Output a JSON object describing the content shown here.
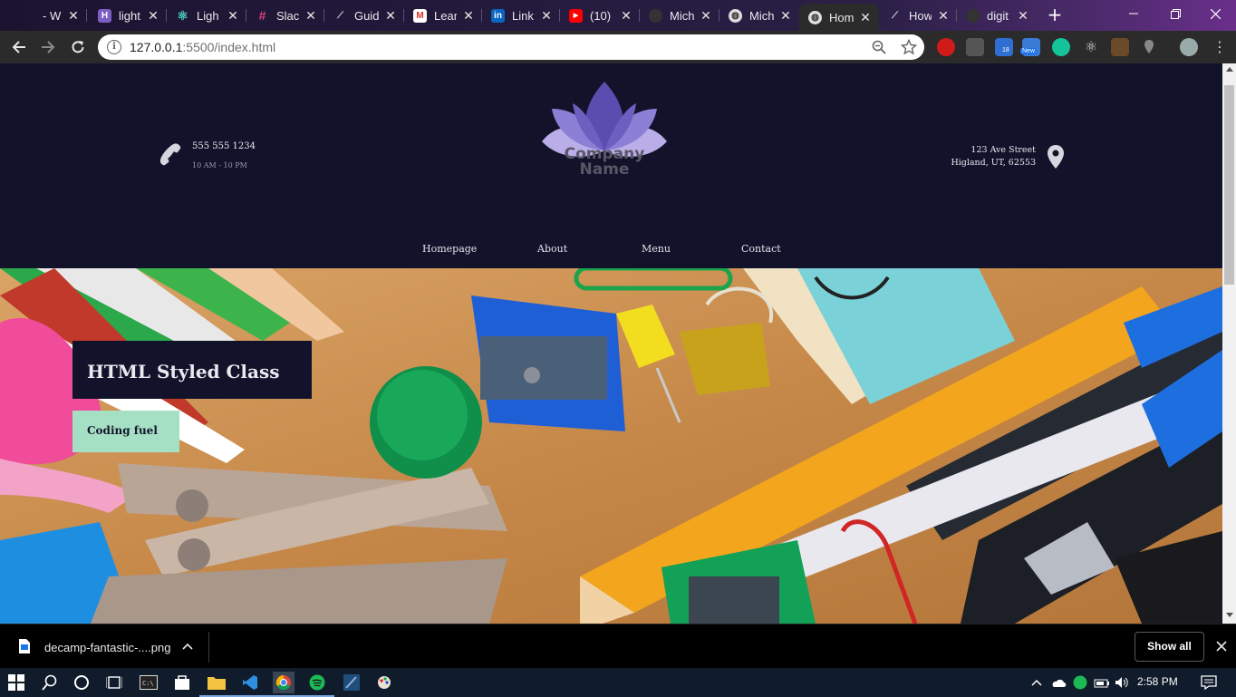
{
  "browser": {
    "tabs": [
      {
        "title": "- Wh",
        "icon": "generic-icon"
      },
      {
        "title": "light",
        "icon": "heroku-icon"
      },
      {
        "title": "Ligh",
        "icon": "react-icon"
      },
      {
        "title": "Slack",
        "icon": "slack-icon"
      },
      {
        "title": "Guid",
        "icon": "chart-icon"
      },
      {
        "title": "Lear",
        "icon": "gmail-icon"
      },
      {
        "title": "Link",
        "icon": "linkedin-icon"
      },
      {
        "title": "(10)",
        "icon": "youtube-icon"
      },
      {
        "title": "Mich",
        "icon": "github-icon"
      },
      {
        "title": "Mich",
        "icon": "globe-icon"
      },
      {
        "title": "Hom",
        "icon": "globe-icon",
        "active": true
      },
      {
        "title": "How",
        "icon": "chart-icon"
      },
      {
        "title": "digit",
        "icon": "github-icon"
      }
    ],
    "url_host": "127.0.0.1",
    "url_rest": ":5500/index.html",
    "ext_badge_1": "18",
    "ext_badge_2": "New"
  },
  "site": {
    "phone": "555 555 1234",
    "hours": "10 AM - 10 PM",
    "address_line1": "123 Ave Street",
    "address_line2": "Higland, UT, 62553",
    "logo_line1": "Company",
    "logo_line2": "Name",
    "nav": [
      "Homepage",
      "About",
      "Menu",
      "Contact"
    ],
    "hero_title": "HTML Styled Class",
    "hero_button": "Coding fuel"
  },
  "colors": {
    "header_bg": "#12132b",
    "accent_button": "#a5e0c4",
    "logo_purple": "#6c5fc0"
  },
  "downloads": {
    "file": "decamp-fantastic-....png",
    "show_all": "Show all"
  },
  "taskbar": {
    "time": "2:58 PM"
  }
}
